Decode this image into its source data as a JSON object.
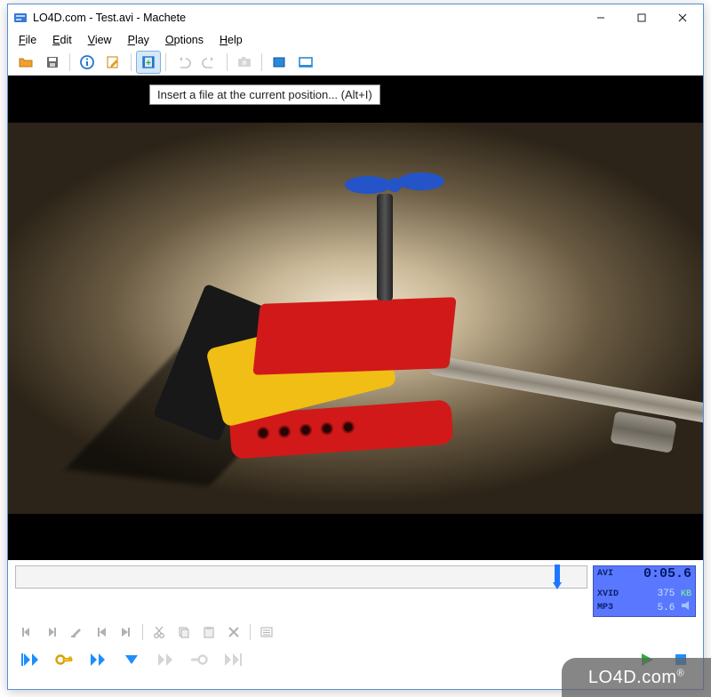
{
  "titlebar": {
    "title": "LO4D.com - Test.avi - Machete"
  },
  "menu": {
    "file": "File",
    "edit": "Edit",
    "view": "View",
    "play": "Play",
    "options": "Options",
    "help": "Help"
  },
  "toolbar": {
    "tooltip": "Insert a file at the current position... (Alt+I)"
  },
  "info": {
    "format": "AVI",
    "time": "0:05.6",
    "vcodec": "XVID",
    "vbr": "375",
    "vbr_unit": "KB",
    "acodec": "MP3",
    "abr": "5.6"
  },
  "watermark": "LO4D.com"
}
